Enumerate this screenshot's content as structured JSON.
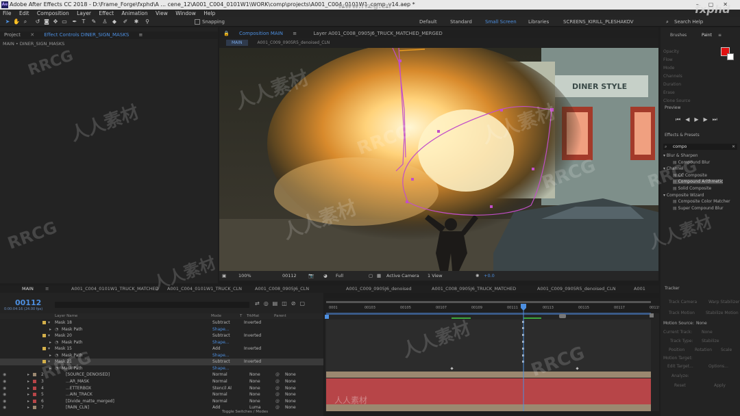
{
  "window": {
    "title": "Adobe After Effects CC 2018 - D:\\Frame_Forge\\fxphd\\A ... cene_12\\A001_C004_0101W1\\WORK\\comp\\projects\\A001_C004_0101W1_comp_v14.aep *",
    "app_icon": "Ae"
  },
  "menu": [
    "File",
    "Edit",
    "Composition",
    "Layer",
    "Effect",
    "Animation",
    "View",
    "Window",
    "Help"
  ],
  "toolbar": {
    "snapping": "Snapping",
    "workspaces": [
      "Default",
      "Standard",
      "Small Screen",
      "Libraries",
      "SCREENS_KIRILL_PLESHAKOV"
    ],
    "active_workspace": "Small Screen",
    "search": "Search Help"
  },
  "left_panel": {
    "tabs": [
      "Project",
      "Effect Controls DINER_SIGN_MASKS"
    ],
    "subtitle": "MAIN • DINER_SIGN_MASKS"
  },
  "viewer": {
    "tabs": [
      "Composition MAIN",
      "Layer A001_C008_0905J6_TRUCK_MATCHED_MERGED"
    ],
    "subtabs": [
      "MAIN",
      "A001_C009_0905R5_denoised_CLN"
    ],
    "sign_text": "DINER STYLE",
    "bar": {
      "zoom": "100%",
      "timecode": "00112",
      "resolution": "Full",
      "camera": "Active Camera",
      "views": "1 View",
      "exposure": "+0.0"
    }
  },
  "timeline": {
    "tabs": [
      "MAIN",
      "A001_C004_0101W1_TRUCK_MATCHED",
      "A001_C004_0101W1_TRUCK_CLN",
      "A001_C008_0905J6_CLN",
      "A001_C009_0905J6_denoised",
      "A001_C008_0905J6_TRUCK_MATCHED",
      "A001_C009_0905R5_denoised_CLN",
      "A001"
    ],
    "timecode": "00112",
    "timecode_sub": "0:00:04:16 (24.00 fps)",
    "columns": {
      "layer_name": "Layer Name",
      "mode": "Mode",
      "t": "T",
      "trkmat": "TrkMat",
      "parent": "Parent"
    },
    "ruler": [
      "0001",
      "00103",
      "00105",
      "00107",
      "00109",
      "00111",
      "00113",
      "00115",
      "00117",
      "00119"
    ],
    "rows": [
      {
        "num": "",
        "name": "Mask 18",
        "mode": "Subtract",
        "extra": "Inverted",
        "parent": "",
        "kind": "mask"
      },
      {
        "num": "",
        "name": "Mask Path",
        "mode": "Shape...",
        "extra": "",
        "parent": "",
        "kind": "prop"
      },
      {
        "num": "",
        "name": "Mask 20",
        "mode": "Subtract",
        "extra": "Inverted",
        "parent": "",
        "kind": "mask"
      },
      {
        "num": "",
        "name": "Mask Path",
        "mode": "Shape...",
        "extra": "",
        "parent": "",
        "kind": "prop"
      },
      {
        "num": "",
        "name": "Mask 15",
        "mode": "Add",
        "extra": "Inverted",
        "parent": "",
        "kind": "mask"
      },
      {
        "num": "",
        "name": "Mask Path",
        "mode": "Shape...",
        "extra": "",
        "parent": "",
        "kind": "prop"
      },
      {
        "num": "",
        "name": "Mask 21",
        "mode": "Subtract",
        "extra": "Inverted",
        "parent": "",
        "kind": "mask",
        "selected": true
      },
      {
        "num": "",
        "name": "Mask Path",
        "mode": "Shape...",
        "extra": "",
        "parent": "",
        "kind": "prop"
      },
      {
        "num": "2",
        "name": "[SOURCE_DENOISED]",
        "mode": "Normal",
        "extra": "None",
        "parent": "None",
        "kind": "layer"
      },
      {
        "num": "3",
        "name": "...AR_MASK",
        "mode": "Normal",
        "extra": "None",
        "parent": "None",
        "kind": "layer"
      },
      {
        "num": "4",
        "name": "...ETTERBOX",
        "mode": "Stencil Al",
        "extra": "None",
        "parent": "None",
        "kind": "layer"
      },
      {
        "num": "5",
        "name": "...AIN_TRACK",
        "mode": "Normal",
        "extra": "None",
        "parent": "None",
        "kind": "layer"
      },
      {
        "num": "6",
        "name": "[Divide_matte_merged]",
        "mode": "Normal",
        "extra": "None",
        "parent": "None",
        "kind": "layer"
      },
      {
        "num": "7",
        "name": "[RAIN_CLN]",
        "mode": "Add",
        "extra": "Luma",
        "parent": "None",
        "kind": "layer"
      }
    ],
    "footer": "Toggle Switches / Modes"
  },
  "right_panel": {
    "tabs": [
      "Brushes",
      "Paint"
    ],
    "paint_fields": [
      "Opacity",
      "Flow",
      "Mode",
      "Channels",
      "Duration",
      "Erase",
      "Clone Source"
    ],
    "preview": "Preview",
    "effects_title": "Effects & Presets",
    "search_value": "compo",
    "groups": [
      {
        "name": "Blur & Sharpen",
        "items": [
          "Compound Blur"
        ]
      },
      {
        "name": "Channel",
        "items": [
          "CC Composite",
          "Compound Arithmetic",
          "Solid Composite"
        ]
      },
      {
        "name": "Composite Wizard",
        "items": [
          "Composite Color Matcher",
          "Super Compound Blur"
        ]
      }
    ],
    "highlighted": "Compound Arithmetic",
    "tracker": {
      "title": "Tracker",
      "buttons": [
        "Track Camera",
        "Warp Stabilizer",
        "Track Motion",
        "Stabilize Motion"
      ],
      "motion_source_label": "Motion Source:",
      "motion_source": "None",
      "current_track_label": "Current Track:",
      "current_track": "None",
      "track_type_label": "Track Type:",
      "track_type": "Stabilize",
      "checks": [
        "Position",
        "Rotation",
        "Scale"
      ],
      "motion_target": "Motion Target:",
      "edit_target": "Edit Target...",
      "options": "Options...",
      "analyze": "Analyze:",
      "reset": "Reset",
      "apply": "Apply"
    }
  },
  "watermarks": [
    "RRCG",
    "人人素材",
    "www.rrcg.cn",
    "fxphd"
  ],
  "colors": {
    "accent": "#4d8fe0",
    "mask_path": "#c24fc8",
    "paint_fg": "#e01010",
    "layer_red": "#b74548",
    "layer_tan": "#9b8870"
  }
}
